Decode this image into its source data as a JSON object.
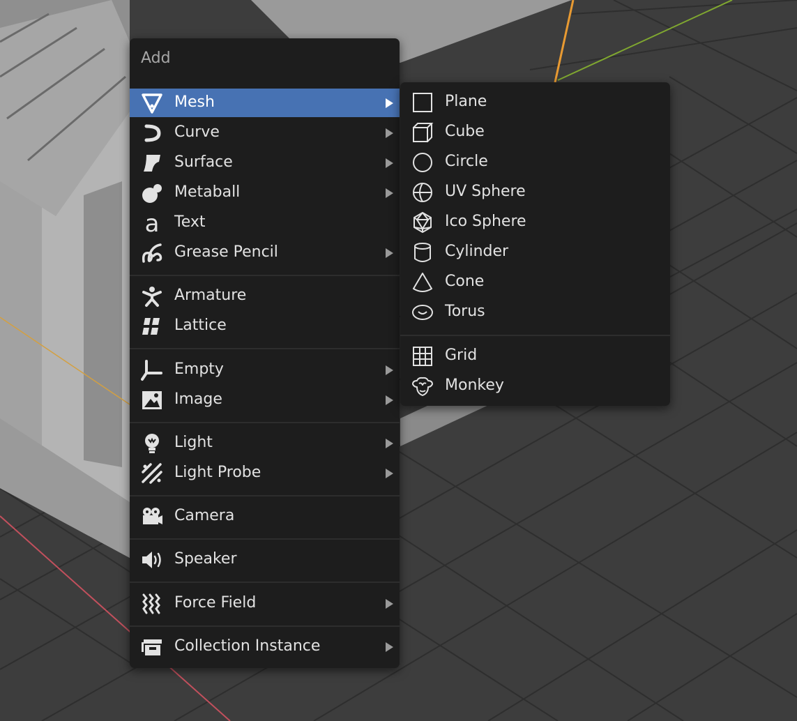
{
  "add_menu": {
    "title": "Add",
    "items": [
      {
        "label": "Mesh",
        "icon": "mesh-icon",
        "submenu": true,
        "active": true
      },
      {
        "label": "Curve",
        "icon": "curve-icon",
        "submenu": true
      },
      {
        "label": "Surface",
        "icon": "surface-icon",
        "submenu": true
      },
      {
        "label": "Metaball",
        "icon": "metaball-icon",
        "submenu": true
      },
      {
        "label": "Text",
        "icon": "text-icon",
        "submenu": false
      },
      {
        "label": "Grease Pencil",
        "icon": "grease-pencil-icon",
        "submenu": true
      },
      {
        "label": "Armature",
        "icon": "armature-icon",
        "submenu": false
      },
      {
        "label": "Lattice",
        "icon": "lattice-icon",
        "submenu": false
      },
      {
        "label": "Empty",
        "icon": "empty-icon",
        "submenu": true
      },
      {
        "label": "Image",
        "icon": "image-icon",
        "submenu": true
      },
      {
        "label": "Light",
        "icon": "light-icon",
        "submenu": true
      },
      {
        "label": "Light Probe",
        "icon": "light-probe-icon",
        "submenu": true
      },
      {
        "label": "Camera",
        "icon": "camera-icon",
        "submenu": false
      },
      {
        "label": "Speaker",
        "icon": "speaker-icon",
        "submenu": false
      },
      {
        "label": "Force Field",
        "icon": "force-field-icon",
        "submenu": true
      },
      {
        "label": "Collection Instance",
        "icon": "collection-instance-icon",
        "submenu": true
      }
    ]
  },
  "mesh_menu": {
    "items": [
      {
        "label": "Plane",
        "icon": "plane-icon"
      },
      {
        "label": "Cube",
        "icon": "cube-icon"
      },
      {
        "label": "Circle",
        "icon": "circle-icon"
      },
      {
        "label": "UV Sphere",
        "icon": "uv-sphere-icon"
      },
      {
        "label": "Ico Sphere",
        "icon": "ico-sphere-icon"
      },
      {
        "label": "Cylinder",
        "icon": "cylinder-icon"
      },
      {
        "label": "Cone",
        "icon": "cone-icon"
      },
      {
        "label": "Torus",
        "icon": "torus-icon"
      },
      {
        "label": "Grid",
        "icon": "grid-icon"
      },
      {
        "label": "Monkey",
        "icon": "monkey-icon"
      }
    ]
  },
  "colors": {
    "menu_bg": "#1d1d1d",
    "highlight": "#4772b3",
    "text": "#e2e2e2",
    "title_text": "#a6a6a6",
    "axis_x": "#c2505d",
    "axis_y": "#80a830",
    "axis_z": "#e89a32"
  }
}
